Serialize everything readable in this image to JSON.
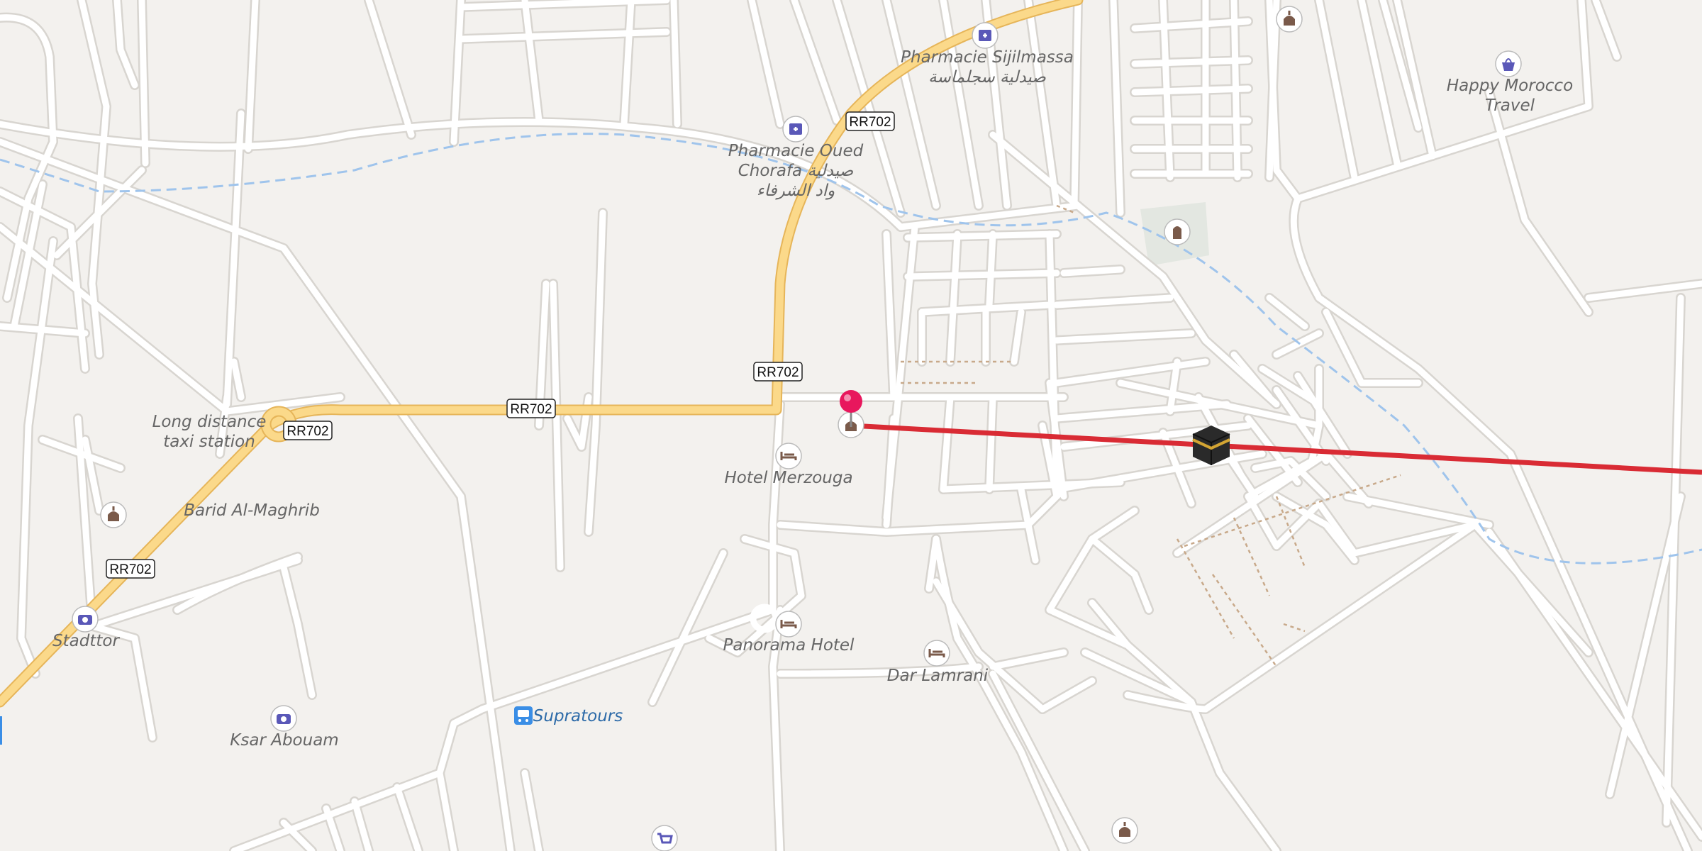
{
  "map": {
    "road_shields": [
      "RR702",
      "RR702",
      "RR702",
      "RR702",
      "RR702"
    ],
    "pois": {
      "pharmacie_sijilmassa": [
        "Pharmacie Sijilmassa",
        "صيدلية سجلماسة"
      ],
      "pharmacie_oued_chorafa": [
        "Pharmacie Oued",
        "Chorafa صيدلية",
        "واد الشرفاء"
      ],
      "happy_morocco_travel": [
        "Happy Morocco",
        "Travel"
      ],
      "long_distance_taxi": [
        "Long distance",
        "taxi station"
      ],
      "barid_al_maghrib": "Barid Al-Maghrib",
      "hotel_merzouga": "Hotel Merzouga",
      "panorama_hotel": "Panorama Hotel",
      "dar_lamrani": "Dar Lamrani",
      "stadttor": "Stadttor",
      "ksar_abouam": "Ksar Abouam",
      "supratours": "Supratours"
    },
    "icons": {
      "pharmacy": "pharmacy-icon",
      "shopping": "shopping-bag-icon",
      "hotel": "bed-icon",
      "viewpoint": "camera-icon",
      "mosque": "mosque-icon",
      "cemetery": "tombstone-icon",
      "bus": "bus-icon",
      "supermarket": "shopping-cart-icon",
      "marker": "location-pin-marker",
      "qibla": "kaaba-icon"
    },
    "colors": {
      "background": "#f3f1ee",
      "main_road": "#fbd98a",
      "river": "#9fc4ec",
      "qibla_line": "#d92b34",
      "pin": "#e8175d",
      "poi_purple": "#5a58b8",
      "poi_brown": "#7a5a4a"
    }
  }
}
